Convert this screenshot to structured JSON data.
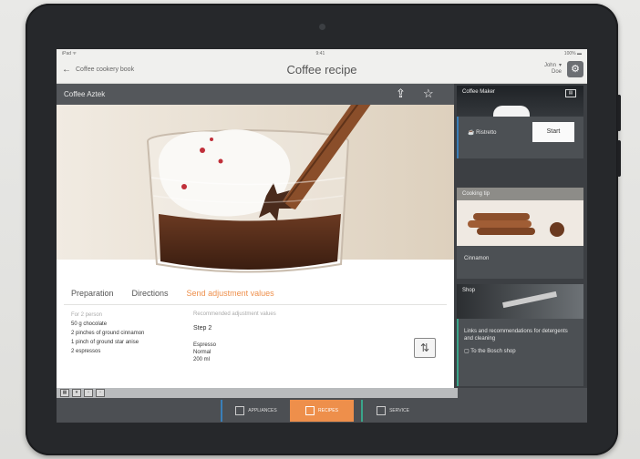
{
  "status": {
    "left": "iPad ᯤ",
    "center": "9:41",
    "right": "100% ▬"
  },
  "nav": {
    "back_label": "Coffee cookery book",
    "title": "Coffee recipe",
    "user_line1": "John",
    "user_line2": "Doe"
  },
  "recipe": {
    "name": "Coffee Aztek"
  },
  "tabs": [
    "Preparation",
    "Directions",
    "Send adjustment values"
  ],
  "preparation": {
    "portion": "For 2 person",
    "ingredients": [
      "50 g chocolate",
      "2 pinches of ground cinnamon",
      "1 pinch of ground star anise",
      "2 espressos"
    ]
  },
  "adjustment": {
    "heading": "Recommended adjustment values",
    "step": "Step 2",
    "values": [
      "Espresso",
      "Normal",
      "200 ml"
    ]
  },
  "sidebar": {
    "coffee_maker": {
      "title": "Coffee Maker",
      "option": "Ristretto",
      "start_label": "Start"
    },
    "cooking_tip": {
      "title": "Cooking tip",
      "caption": "Cinnamon"
    },
    "shop": {
      "title": "Shop",
      "text": "Links and recommendations for detergents and cleaning",
      "link": "To the Bosch shop"
    }
  },
  "bottom_tabs": [
    "APPLIANCES",
    "RECIPES",
    "SERVICE"
  ],
  "colors": {
    "accent": "#ee8f4b",
    "card_blue": "#3a7fb8",
    "bezel": "#26282b"
  }
}
